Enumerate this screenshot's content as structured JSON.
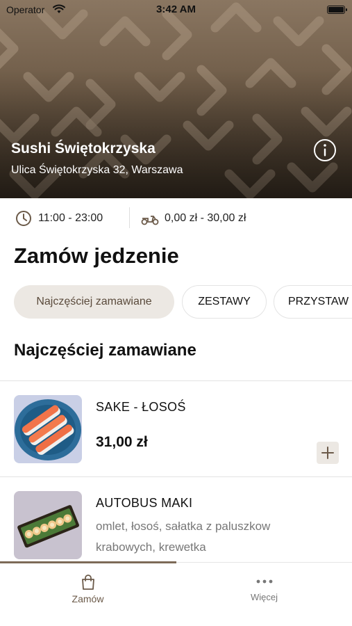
{
  "status_bar": {
    "operator": "Operator",
    "time": "3:42 AM"
  },
  "restaurant": {
    "name": "Sushi Świętokrzyska",
    "address": "Ulica Świętokrzyska 32, Warszawa"
  },
  "info": {
    "hours": "11:00 - 23:00",
    "delivery_price": "0,00 zł - 30,00 zł"
  },
  "main": {
    "title": "Zamów jedzenie",
    "categories": [
      {
        "label": "Najczęściej zamawiane",
        "active": true
      },
      {
        "label": "ZESTAWY",
        "active": false
      },
      {
        "label": "PRZYSTAW",
        "active": false
      }
    ],
    "section_title": "Najczęściej zamawiane",
    "items": [
      {
        "name": "SAKE - ŁOSOŚ",
        "price": "31,00 zł",
        "description": ""
      },
      {
        "name": "AUTOBUS MAKI",
        "price": "",
        "description": "omlet, łosoś, sałatka z paluszkow krabowych, krewetka"
      }
    ]
  },
  "tab_bar": {
    "tabs": [
      {
        "label": "Zamów",
        "icon": "bag-icon",
        "active": true
      },
      {
        "label": "Więcej",
        "icon": "more-dots-icon",
        "active": false
      }
    ]
  },
  "colors": {
    "accent": "#7d6a57",
    "chip_active_bg": "#ece8e3"
  }
}
